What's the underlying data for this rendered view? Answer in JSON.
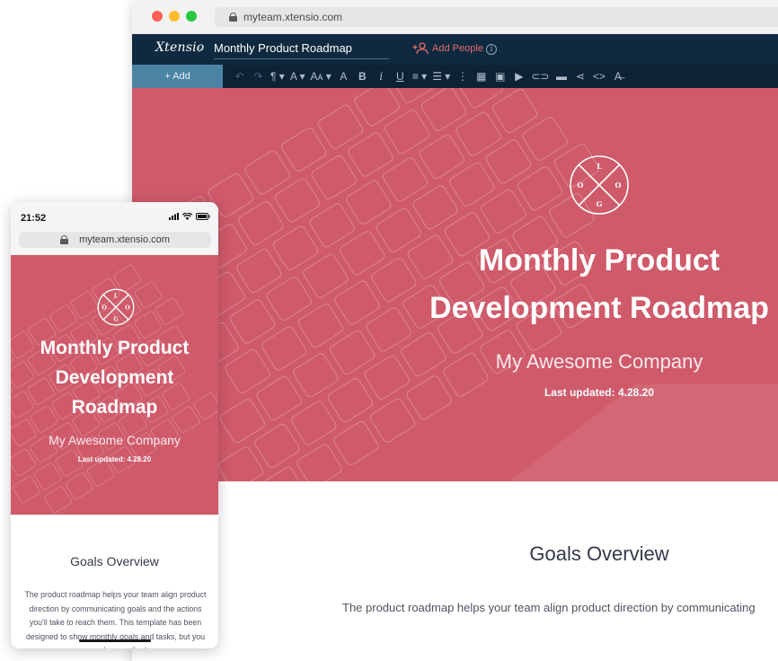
{
  "desktop": {
    "url": "myteam.xtensio.com",
    "app_logo": "Xtensio",
    "document_title": "Monthly Product Roadmap",
    "add_people_label": "Add People",
    "add_label": "+ Add",
    "toolbar": {
      "undo": "↶",
      "redo": "↷",
      "paragraph": "¶ ▾",
      "font": "A ▾",
      "size": "Aᴀ ▾",
      "bold": "B",
      "italic": "i",
      "underline": "U",
      "align": "≡ ▾",
      "list": "☰ ▾",
      "more": "⋮",
      "table": "▦",
      "image": "▣",
      "video": "▶",
      "link": "⊂⊃",
      "embed": "▬",
      "share": "⋖",
      "code": "<>",
      "clear": "A̶"
    },
    "hero": {
      "logo_letters": [
        "L",
        "O",
        "O",
        "G"
      ],
      "title": "Monthly Product Development Roadmap",
      "subtitle": "My Awesome Company",
      "last_updated": "Last updated: 4.28.20",
      "color": "#cf5a6a"
    },
    "goals": {
      "heading": "Goals Overview",
      "text": "The product roadmap helps your team align product direction by communicating"
    }
  },
  "mobile": {
    "time": "21:52",
    "url": "myteam.xtensio.com",
    "hero": {
      "title": "Monthly Product Development Roadmap",
      "subtitle": "My Awesome Company",
      "last_updated": "Last updated: 4.28.20"
    },
    "goals": {
      "heading": "Goals Overview",
      "text": "The product roadmap helps your team align product direction by communicating goals and the actions you'll take to reach them. This template has been designed to show monthly goals and tasks, but you can always adjust"
    }
  }
}
